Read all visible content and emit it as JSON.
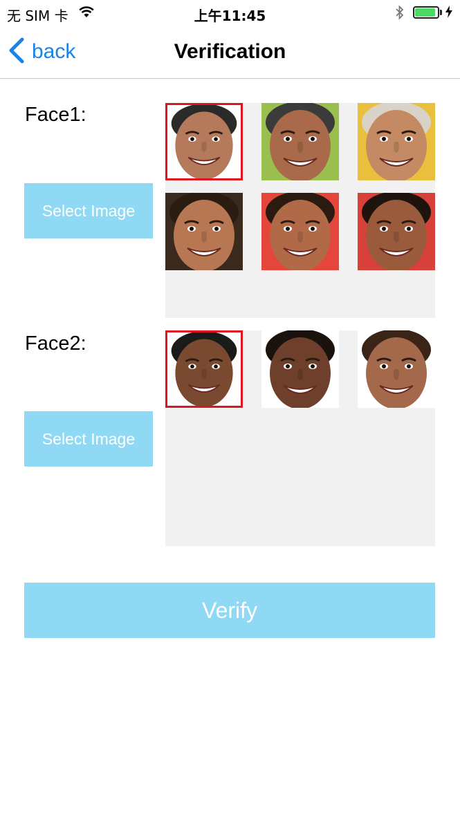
{
  "status_bar": {
    "carrier": "无 SIM 卡",
    "time": "上午11:45",
    "battery_level": 0.9
  },
  "nav": {
    "back_label": "back",
    "title": "Verification"
  },
  "face1": {
    "label": "Face1:",
    "select_label": "Select Image",
    "thumbs": [
      {
        "subject": "man-1",
        "selected": true,
        "bg": "#ffffff",
        "skin": "#b57a5c",
        "hair": "#2a2a2a"
      },
      {
        "subject": "man-2",
        "selected": false,
        "bg": "#9bbf4e",
        "skin": "#a9694b",
        "hair": "#3b3b3b"
      },
      {
        "subject": "woman-1",
        "selected": false,
        "bg": "#e9c03d",
        "skin": "#c48a64",
        "hair": "#d9d2c8"
      },
      {
        "subject": "woman-2",
        "selected": false,
        "bg": "#3a2a1e",
        "skin": "#b77752",
        "hair": "#2b1c12"
      },
      {
        "subject": "girl-1",
        "selected": false,
        "bg": "#e4463c",
        "skin": "#b16a47",
        "hair": "#2b1a10"
      },
      {
        "subject": "girl-2",
        "selected": false,
        "bg": "#d8403a",
        "skin": "#9a5a3c",
        "hair": "#1e140d"
      }
    ]
  },
  "face2": {
    "label": "Face2:",
    "select_label": "Select Image",
    "thumbs": [
      {
        "subject": "man-3",
        "selected": true,
        "bg": "#ffffff",
        "skin": "#7a4a30",
        "hair": "#1a1a1a"
      },
      {
        "subject": "woman-3",
        "selected": false,
        "bg": "#ffffff",
        "skin": "#6e3f2a",
        "hair": "#1a120d"
      },
      {
        "subject": "baby-1",
        "selected": false,
        "bg": "#ffffff",
        "skin": "#a4694a",
        "hair": "#3a2418"
      }
    ]
  },
  "verify_label": "Verify",
  "colors": {
    "accent_blue": "#1a82e8",
    "button_bg": "#8fd9f5",
    "selection_border": "#e0141e",
    "panel_bg": "#f1f1f1"
  }
}
